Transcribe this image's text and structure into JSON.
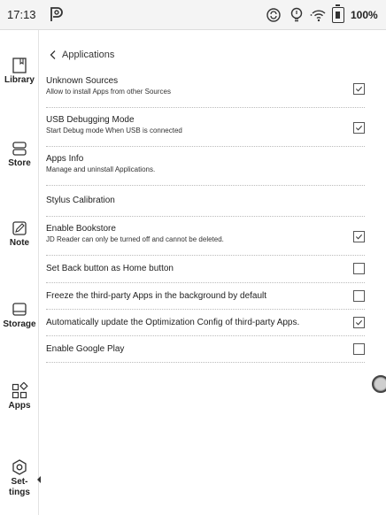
{
  "status_bar": {
    "time": "17:13",
    "battery_percent": "100%",
    "icons": [
      "p-logo-icon",
      "sync-icon",
      "lightbulb-icon",
      "wifi-icon",
      "battery-icon"
    ]
  },
  "sidebar": {
    "items": [
      {
        "label": "Library",
        "icon": "library-icon"
      },
      {
        "label": "Store",
        "icon": "store-icon"
      },
      {
        "label": "Note",
        "icon": "note-icon"
      },
      {
        "label": "Storage",
        "icon": "storage-icon"
      },
      {
        "label": "Apps",
        "icon": "apps-icon"
      },
      {
        "label": "Set-\ntings",
        "icon": "settings-icon",
        "active": true
      }
    ]
  },
  "header": {
    "back_icon": "chevron-left-icon",
    "title": "Applications"
  },
  "settings": [
    {
      "title": "Unknown Sources",
      "description": "Allow to install Apps from other Sources",
      "checkbox": true,
      "checked": true
    },
    {
      "title": "USB Debugging Mode",
      "description": "Start Debug mode When USB is connected",
      "checkbox": true,
      "checked": true
    },
    {
      "title": "Apps Info",
      "description": "Manage and uninstall Applications.",
      "checkbox": false,
      "checked": false
    },
    {
      "title": "Stylus Calibration",
      "description": "",
      "checkbox": false,
      "checked": false
    },
    {
      "title": "Enable Bookstore",
      "description": "JD Reader can only be turned off and cannot be deleted.",
      "checkbox": true,
      "checked": true
    },
    {
      "title": "Set Back button as Home button",
      "description": "",
      "checkbox": true,
      "checked": false
    },
    {
      "title": "Freeze the third-party Apps in the background by default",
      "description": "",
      "checkbox": true,
      "checked": false
    },
    {
      "title": "Automatically update the Optimization Config of third-party Apps.",
      "description": "",
      "checkbox": true,
      "checked": true
    },
    {
      "title": "Enable Google Play",
      "description": "",
      "checkbox": true,
      "checked": false
    }
  ],
  "floating_button": {
    "icon": "floating-ball-icon"
  }
}
